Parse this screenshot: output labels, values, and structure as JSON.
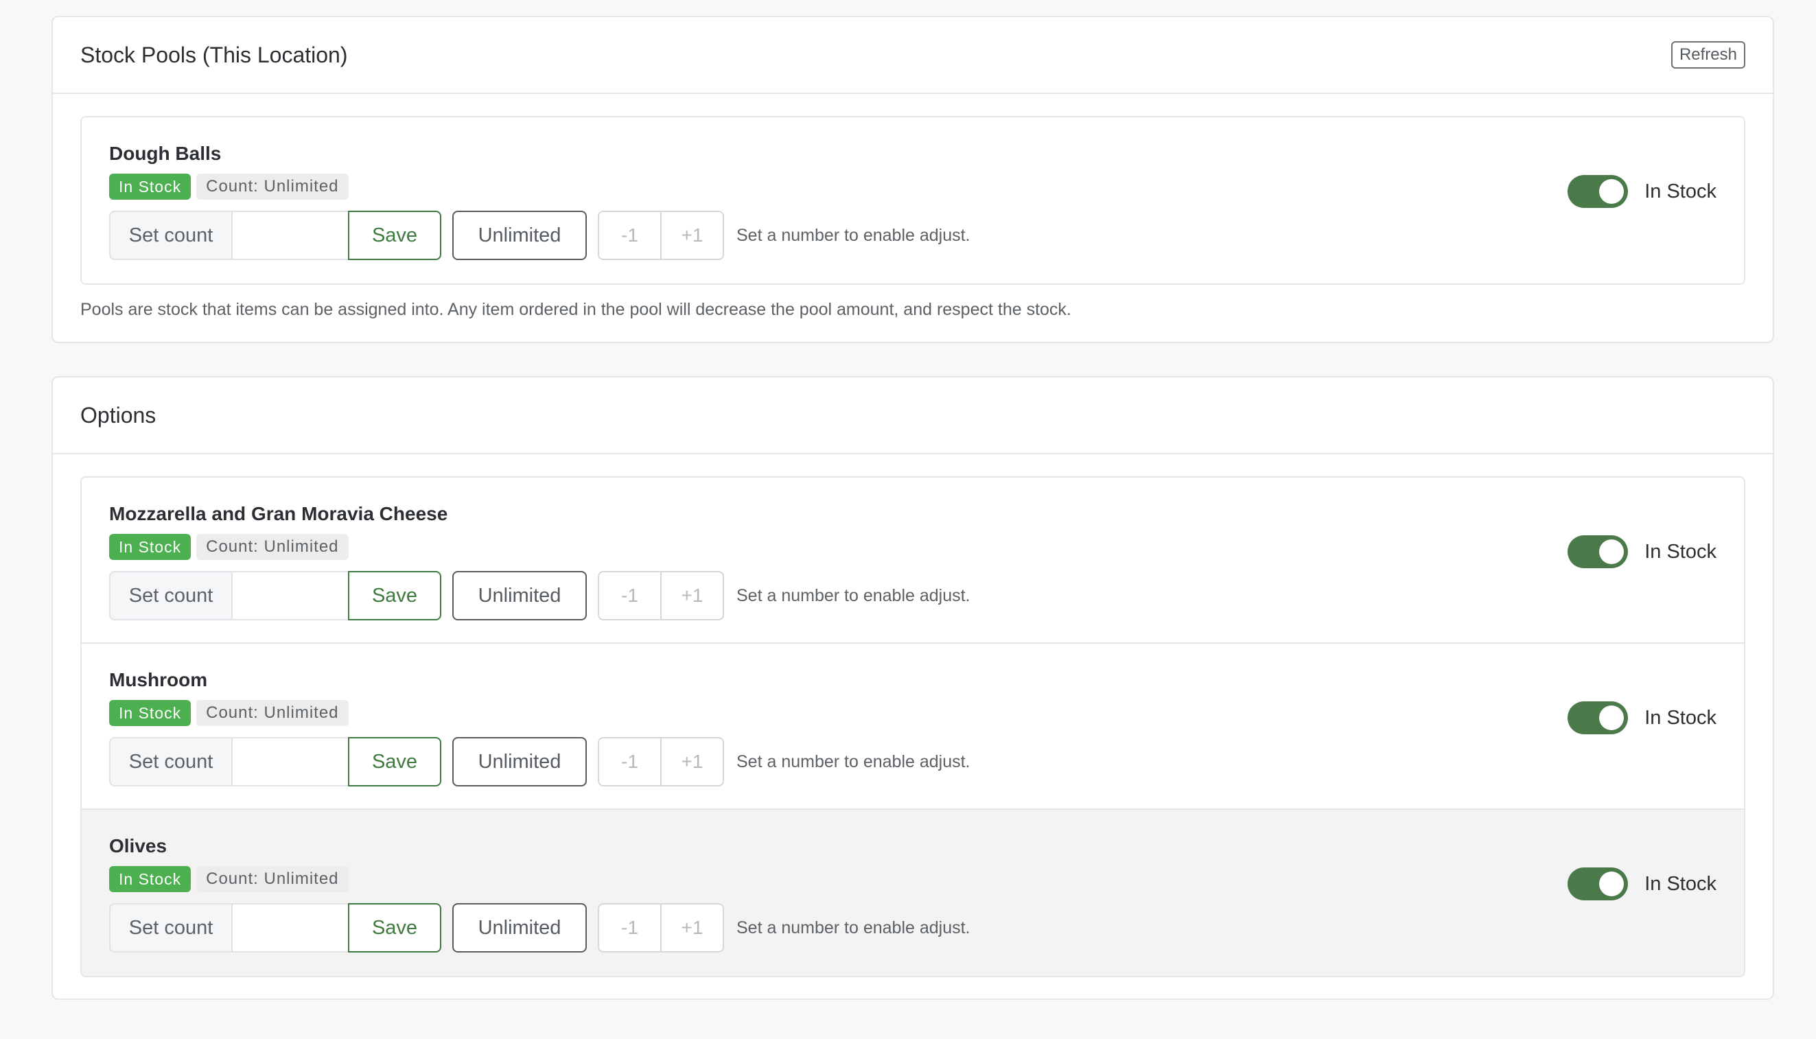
{
  "stock_pools": {
    "title": "Stock Pools (This Location)",
    "refresh_label": "Refresh",
    "footnote": "Pools are stock that items can be assigned into. Any item ordered in the pool will decrease the pool amount, and respect the stock.",
    "items": [
      {
        "name": "Dough Balls",
        "status_badge": "In Stock",
        "count_badge": "Count: Unlimited",
        "set_count_label": "Set count",
        "set_count_value": "",
        "save_label": "Save",
        "unlimited_label": "Unlimited",
        "minus_label": "-1",
        "plus_label": "+1",
        "hint": "Set a number to enable adjust.",
        "toggle_on": true,
        "toggle_label": "In Stock"
      }
    ]
  },
  "options": {
    "title": "Options",
    "items": [
      {
        "name": "Mozzarella and Gran Moravia Cheese",
        "status_badge": "In Stock",
        "count_badge": "Count: Unlimited",
        "set_count_label": "Set count",
        "set_count_value": "",
        "save_label": "Save",
        "unlimited_label": "Unlimited",
        "minus_label": "-1",
        "plus_label": "+1",
        "hint": "Set a number to enable adjust.",
        "toggle_on": true,
        "toggle_label": "In Stock"
      },
      {
        "name": "Mushroom",
        "status_badge": "In Stock",
        "count_badge": "Count: Unlimited",
        "set_count_label": "Set count",
        "set_count_value": "",
        "save_label": "Save",
        "unlimited_label": "Unlimited",
        "minus_label": "-1",
        "plus_label": "+1",
        "hint": "Set a number to enable adjust.",
        "toggle_on": true,
        "toggle_label": "In Stock"
      },
      {
        "name": "Olives",
        "status_badge": "In Stock",
        "count_badge": "Count: Unlimited",
        "set_count_label": "Set count",
        "set_count_value": "",
        "save_label": "Save",
        "unlimited_label": "Unlimited",
        "minus_label": "-1",
        "plus_label": "+1",
        "hint": "Set a number to enable adjust.",
        "toggle_on": true,
        "toggle_label": "In Stock"
      }
    ]
  },
  "colors": {
    "accent_green": "#4caf50",
    "toggle_green": "#4a7a4a",
    "save_green": "#3f7a3f",
    "page_bg": "#f7f8fa"
  }
}
